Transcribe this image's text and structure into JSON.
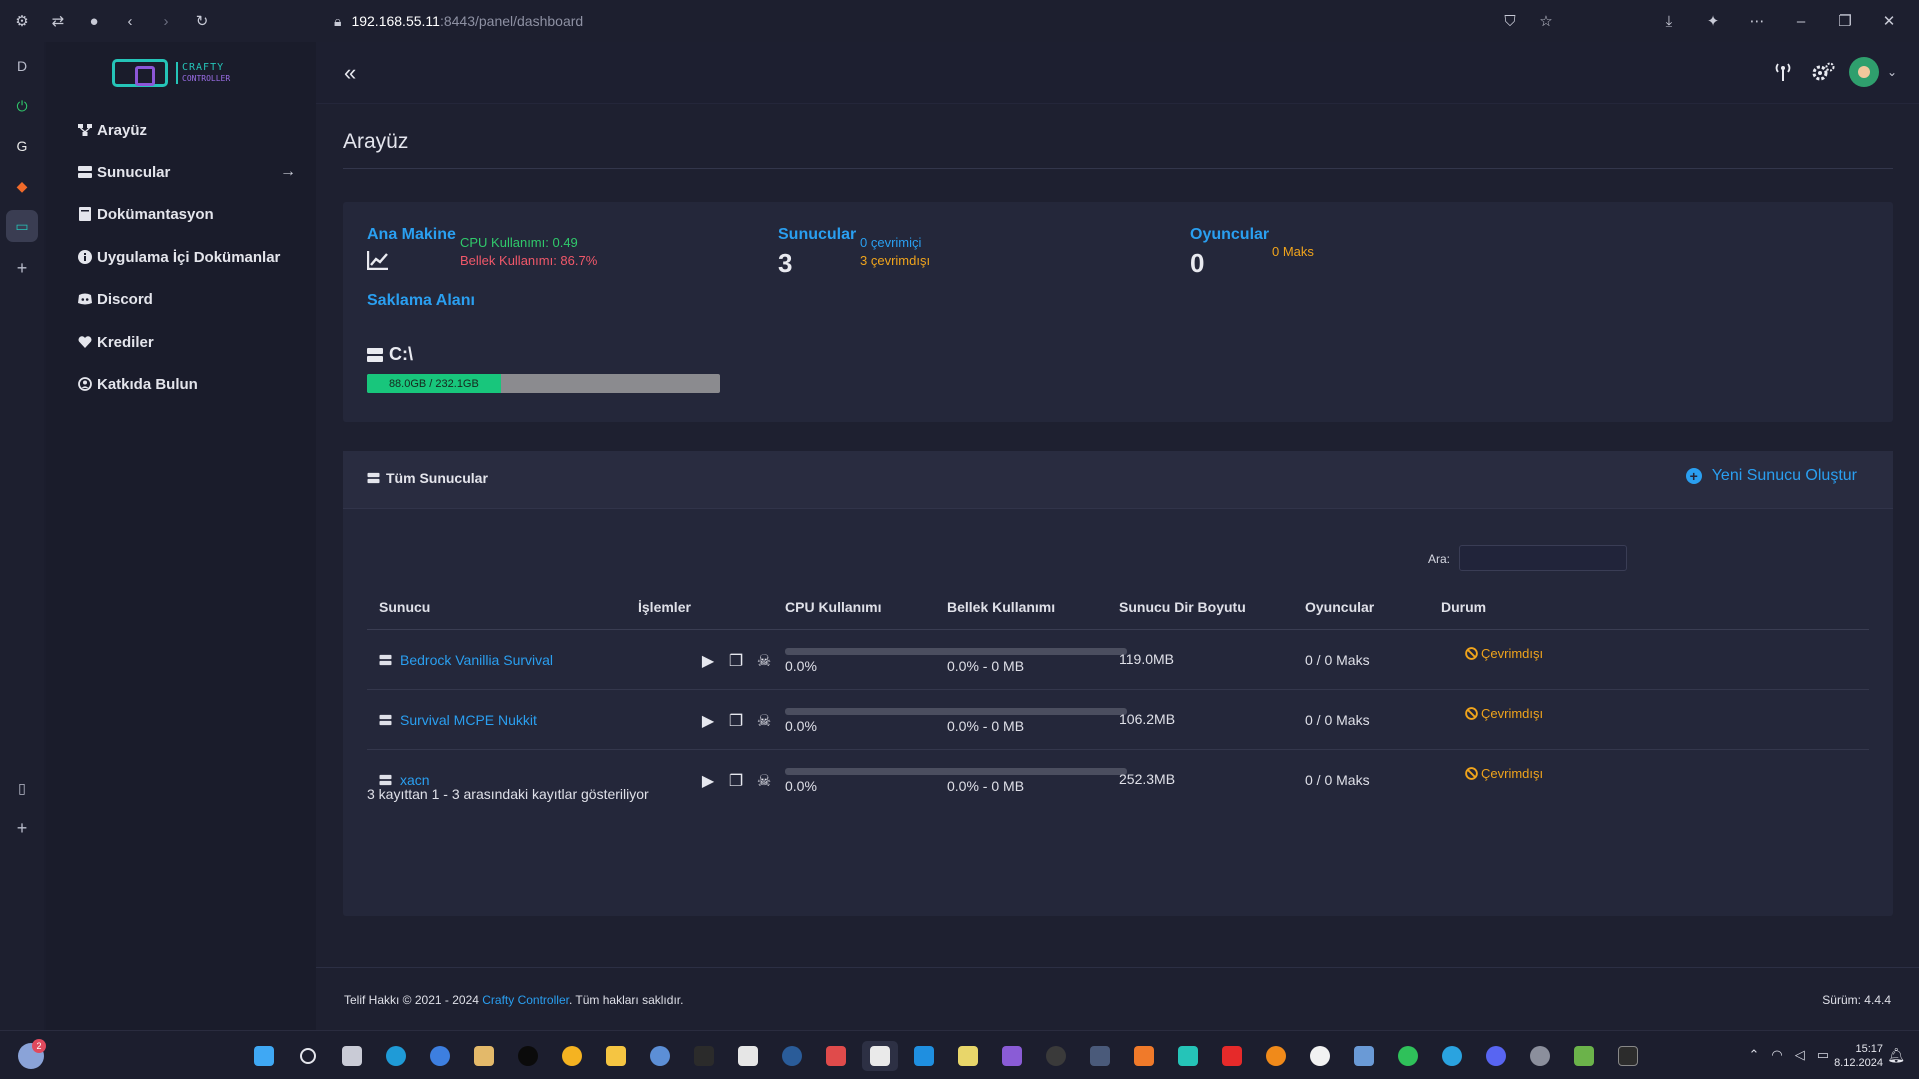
{
  "browser": {
    "url_host": "192.168.55.11",
    "url_path": ":8443/panel/dashboard",
    "strip_letter": "D"
  },
  "app": {
    "logo_line1": "CRAFTY",
    "logo_line2": "CONTROLLER"
  },
  "sidebar": {
    "items": [
      {
        "label": "Arayüz",
        "icon": "sitemap-icon"
      },
      {
        "label": "Sunucular",
        "icon": "server-icon"
      },
      {
        "label": "Dokümantasyon",
        "icon": "book-icon"
      },
      {
        "label": "Uygulama İçi Dokümanlar",
        "icon": "info-icon"
      },
      {
        "label": "Discord",
        "icon": "discord-icon"
      },
      {
        "label": "Krediler",
        "icon": "heart-icon"
      },
      {
        "label": "Katkıda Bulun",
        "icon": "user-icon"
      }
    ]
  },
  "page": {
    "title": "Arayüz"
  },
  "stats": {
    "host_label": "Ana Makine",
    "cpu_usage": "CPU Kullanımı: 0.49",
    "memory_usage": "Bellek Kullanımı: 86.7%",
    "servers_label": "Sunucular",
    "servers_count": "3",
    "servers_online": "0 çevrimiçi",
    "servers_offline": "3 çevrimdışı",
    "players_label": "Oyuncular",
    "players_count": "0",
    "players_max": "0 Maks",
    "storage_label": "Saklama Alanı",
    "drive": "C:\\",
    "storage_text": "88.0GB / 232.1GB",
    "storage_fraction": 0.379
  },
  "servers": {
    "title": "Tüm Sunucular",
    "new_server": "Yeni Sunucu Oluştur",
    "search_label": "Ara:",
    "search_value": "",
    "columns": [
      "Sunucu",
      "İşlemler",
      "CPU Kullanımı",
      "Bellek Kullanımı",
      "Sunucu Dir Boyutu",
      "Oyuncular",
      "Durum"
    ],
    "rows": [
      {
        "name": "Bedrock Vanillia Survival",
        "cpu": "0.0%",
        "memory": "0.0% - 0 MB",
        "size": "119.0MB",
        "players": "0 / 0 Maks",
        "status": "Çevrimdışı"
      },
      {
        "name": "Survival MCPE Nukkit",
        "cpu": "0.0%",
        "memory": "0.0% - 0 MB",
        "size": "106.2MB",
        "players": "0 / 0 Maks",
        "status": "Çevrimdışı"
      },
      {
        "name": "xacn",
        "cpu": "0.0%",
        "memory": "0.0% - 0 MB",
        "size": "252.3MB",
        "players": "0 / 0 Maks",
        "status": "Çevrimdışı"
      }
    ],
    "records_info": "3 kayıttan 1 - 3 arasındaki kayıtlar gösteriliyor"
  },
  "footer": {
    "copyright_prefix": "Telif Hakkı © 2021 - 2024 ",
    "brand_link": "Crafty Controller",
    "copyright_suffix": ". Tüm hakları saklıdır.",
    "version": "Sürüm: 4.4.4"
  },
  "taskbar": {
    "weather_badge": "2",
    "time": "15:17",
    "date": "8.12.2024"
  },
  "colors": {
    "accent_blue": "#2a9ff0",
    "online_green": "#30c96b",
    "memory_red": "#f0586a",
    "offline_orange": "#f0a41c",
    "storage_fill": "#18c67c"
  }
}
